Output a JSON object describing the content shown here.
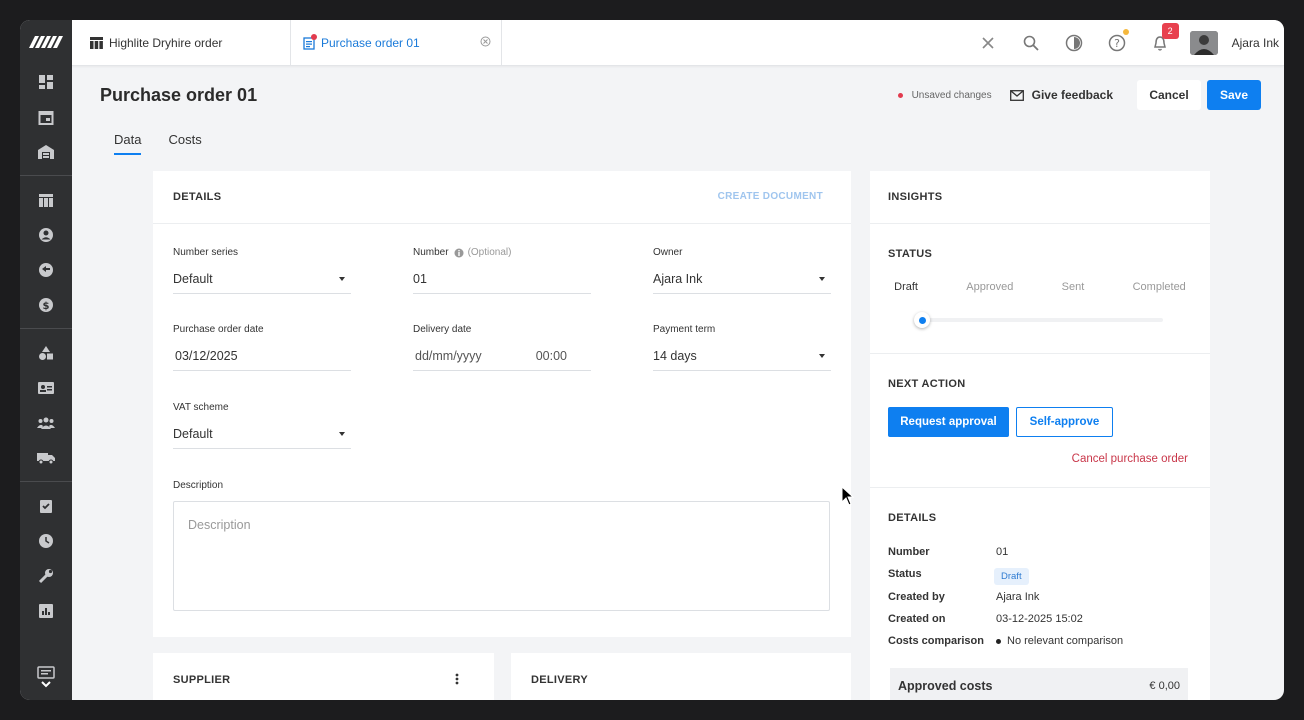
{
  "app": {
    "brand": "mmm"
  },
  "sidebar": {
    "items": [
      "dashboard-icon",
      "calendar-icon",
      "warehouse-icon",
      "table-icon",
      "account-icon",
      "sync-icon",
      "dollar-icon",
      "shapes-icon",
      "contact-card-icon",
      "people-icon",
      "truck-icon",
      "task-icon",
      "clock-icon",
      "wrench-icon",
      "report-icon",
      "chat-icon"
    ]
  },
  "tabs": [
    {
      "label": "Highlite Dryhire order"
    },
    {
      "label": "Purchase order 01"
    }
  ],
  "topbar": {
    "notification_count": "2",
    "user_name": "Ajara Ink"
  },
  "page": {
    "title": "Purchase order 01",
    "unsaved": "Unsaved changes",
    "feedback": "Give feedback",
    "cancel": "Cancel",
    "save": "Save",
    "tabs": [
      "Data",
      "Costs"
    ]
  },
  "details": {
    "header": "DETAILS",
    "create_document": "CREATE DOCUMENT",
    "number_series": {
      "label": "Number series",
      "value": "Default"
    },
    "number": {
      "label": "Number",
      "optional": "(Optional)",
      "value": "01"
    },
    "owner": {
      "label": "Owner",
      "value": "Ajara Ink"
    },
    "po_date": {
      "label": "Purchase order date",
      "value": "03/12/2025"
    },
    "delivery_date": {
      "label": "Delivery date",
      "date_placeholder": "dd/mm/yyyy",
      "time": "00:00"
    },
    "payment_term": {
      "label": "Payment term",
      "value": "14 days"
    },
    "vat_scheme": {
      "label": "VAT scheme",
      "value": "Default"
    },
    "description": {
      "label": "Description",
      "placeholder": "Description"
    }
  },
  "supplier": {
    "header": "SUPPLIER"
  },
  "delivery": {
    "header": "DELIVERY"
  },
  "insights": {
    "header": "INSIGHTS",
    "status_header": "STATUS",
    "steps": [
      "Draft",
      "Approved",
      "Sent",
      "Completed"
    ],
    "current_step": 0,
    "next_action_header": "NEXT ACTION",
    "request_approval": "Request approval",
    "self_approve": "Self-approve",
    "cancel_po": "Cancel purchase order",
    "details_header": "DETAILS",
    "rows": [
      {
        "key": "Number",
        "value": "01"
      },
      {
        "key": "Status",
        "value": "Draft"
      },
      {
        "key": "Created by",
        "value": "Ajara Ink"
      },
      {
        "key": "Created on",
        "value": "03-12-2025 15:02"
      },
      {
        "key": "Costs comparison",
        "value": "No relevant comparison"
      }
    ],
    "approved_costs": {
      "label": "Approved costs",
      "value": "€ 0,00"
    }
  },
  "colors": {
    "accent": "#0e7ff0",
    "danger": "#c9374a",
    "sidebar": "#2f3032"
  }
}
